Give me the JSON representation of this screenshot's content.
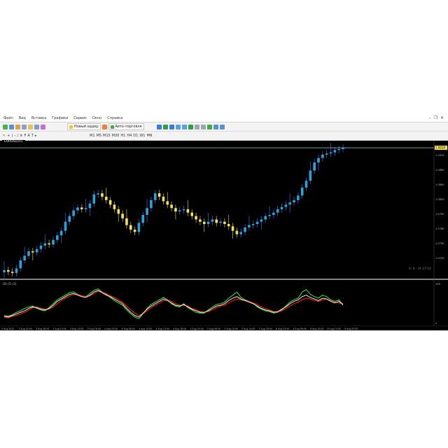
{
  "menu": [
    "Файл",
    "Вид",
    "Вставка",
    "Графики",
    "Сервис",
    "Окно",
    "Справка"
  ],
  "toolbar": {
    "new_order_label": "Новый ордер",
    "autotrading_label": "Авто-торговля",
    "timeframes": [
      "M1",
      "M5",
      "M15",
      "M30",
      "H1",
      "H4",
      "D1",
      "W1",
      "MN"
    ]
  },
  "chart": {
    "tab_label": "EURUSD,H1",
    "current_price_label": "1.0916",
    "price_ticks": [
      "1.0910",
      "1.0880",
      "1.0850",
      "1.0820",
      "1.0790",
      "1.0760",
      "1.0730",
      "1.0700"
    ],
    "countdown_label": "0: 4 : 2t 37:32",
    "indicator_label": "(8)  (5)  (3)",
    "indicator_ticks": [
      "100",
      "0"
    ],
    "time_ticks": [
      "5 Aug 2022",
      "3 Aug 02:00",
      "3 Aug 06:00",
      "3 Aug 10:00",
      "3 Aug 14:00",
      "3 Aug 18:00",
      "4 Aug 03:00",
      "4 Aug 06:00",
      "4 Aug 10:00",
      "4 Aug 14:00",
      "4 Aug 18:00",
      "5 Aug 03:00",
      "5 Aug 06:00",
      "5 Aug 10:00",
      "5 Aug 14:00",
      "5 Aug 18:00",
      "8 Aug 03:00",
      "8 Aug 06:00",
      "8 Aug 10:00",
      "8 Aug 14:00",
      "9 Aug 03:00"
    ],
    "colors": {
      "background": "#000000",
      "bull": "#2aa4d8",
      "bear": "#f2e15a",
      "accent": "#e0e0e0",
      "price_line": "#8fd6d6",
      "stoch_main": "#ffffff",
      "stoch_green": "#33dd33",
      "stoch_red": "#ff1a1a"
    }
  },
  "chart_data": {
    "type": "candlestick",
    "close": [
      1.0705,
      1.0702,
      1.07,
      1.0708,
      1.0722,
      1.073,
      1.0738,
      1.0736,
      1.0742,
      1.0748,
      1.0752,
      1.075,
      1.0758,
      1.0766,
      1.0774,
      1.079,
      1.08,
      1.081,
      1.0815,
      1.0812,
      1.0814,
      1.0822,
      1.0838,
      1.084,
      1.0834,
      1.0828,
      1.082,
      1.0812,
      1.0804,
      1.0796,
      1.0784,
      1.0776,
      1.0772,
      1.0788,
      1.0802,
      1.0814,
      1.0828,
      1.084,
      1.0834,
      1.0826,
      1.082,
      1.0814,
      1.0808,
      1.081,
      1.0812,
      1.0806,
      1.08,
      1.0794,
      1.079,
      1.0786,
      1.079,
      1.0794,
      1.0788,
      1.079,
      1.0786,
      1.0782,
      1.0774,
      1.0768,
      1.0772,
      1.078,
      1.0784,
      1.0786,
      1.079,
      1.0794,
      1.08,
      1.0802,
      1.0806,
      1.0812,
      1.0816,
      1.082,
      1.0824,
      1.0828,
      1.0836,
      1.085,
      1.0862,
      1.088,
      1.0894,
      1.0902,
      1.0908,
      1.091,
      1.0912,
      1.0916,
      1.0918,
      1.092
    ],
    "stochastic": {
      "main": [
        20,
        18,
        22,
        26,
        30,
        34,
        40,
        44,
        42,
        38,
        36,
        40,
        48,
        58,
        64,
        70,
        76,
        78,
        74,
        70,
        68,
        74,
        82,
        86,
        80,
        74,
        70,
        64,
        58,
        52,
        40,
        30,
        22,
        18,
        28,
        38,
        46,
        52,
        58,
        64,
        60,
        54,
        48,
        46,
        50,
        44,
        38,
        34,
        30,
        30,
        34,
        40,
        46,
        48,
        52,
        60,
        66,
        70,
        64,
        60,
        56,
        52,
        46,
        40,
        36,
        34,
        30,
        32,
        38,
        44,
        52,
        58,
        62,
        70,
        74,
        68,
        64,
        60,
        66,
        64,
        58,
        54,
        58,
        50
      ],
      "green": [
        22,
        20,
        24,
        30,
        34,
        40,
        44,
        46,
        40,
        36,
        34,
        42,
        52,
        62,
        68,
        74,
        80,
        82,
        76,
        72,
        70,
        78,
        86,
        90,
        82,
        76,
        68,
        60,
        54,
        48,
        36,
        26,
        18,
        14,
        26,
        40,
        50,
        56,
        62,
        68,
        62,
        52,
        46,
        44,
        52,
        42,
        36,
        30,
        28,
        28,
        36,
        44,
        50,
        52,
        56,
        66,
        74,
        82,
        68,
        62,
        58,
        54,
        44,
        38,
        34,
        32,
        28,
        30,
        36,
        46,
        56,
        62,
        66,
        82,
        88,
        76,
        70,
        66,
        74,
        70,
        62,
        58,
        62,
        48
      ],
      "red": [
        18,
        16,
        20,
        22,
        26,
        30,
        36,
        42,
        44,
        40,
        38,
        38,
        44,
        52,
        60,
        66,
        72,
        76,
        76,
        72,
        70,
        72,
        78,
        84,
        82,
        78,
        72,
        68,
        62,
        56,
        46,
        36,
        28,
        22,
        26,
        34,
        42,
        48,
        54,
        60,
        62,
        58,
        52,
        48,
        48,
        46,
        40,
        36,
        32,
        30,
        32,
        36,
        42,
        46,
        48,
        54,
        60,
        64,
        62,
        60,
        58,
        54,
        50,
        44,
        40,
        36,
        32,
        30,
        34,
        40,
        46,
        52,
        56,
        62,
        66,
        64,
        60,
        58,
        62,
        64,
        60,
        56,
        54,
        52
      ]
    }
  }
}
